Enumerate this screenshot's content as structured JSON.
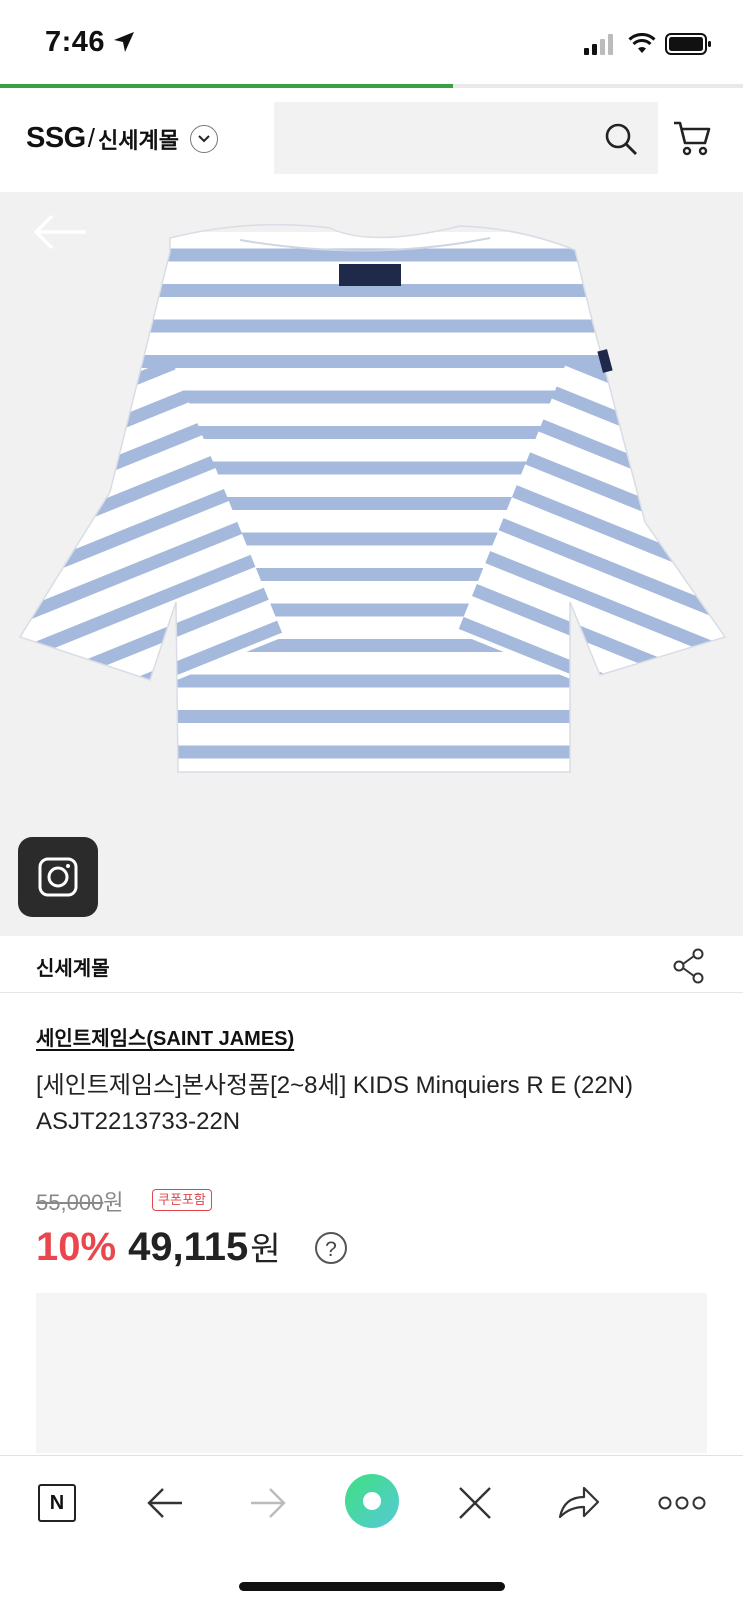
{
  "status_bar": {
    "time": "7:46"
  },
  "page_load_progress": 0.61,
  "header": {
    "logo_brand": "SSG",
    "logo_separator": "/",
    "logo_mall": "신세계몰",
    "search_placeholder": ""
  },
  "store": {
    "name": "신세계몰"
  },
  "product": {
    "brand": "세인트제임스(SAINT JAMES)",
    "title": "[세인트제임스]본사정품[2~8세] KIDS Minquiers R E (22N) ASJT2213733-22N",
    "original_price": "55,000",
    "original_price_unit": "원",
    "coupon_badge": "쿠폰포함",
    "discount": "10%",
    "sale_price": "49,115",
    "sale_price_unit": "원",
    "help_symbol": "?"
  },
  "bottom_nav": {
    "naver_label": "N",
    "items": [
      "naver-home",
      "back",
      "forward",
      "green-dot",
      "close",
      "share",
      "more"
    ]
  },
  "colors": {
    "accent_red": "#e9464e",
    "progress_green": "#3aa043",
    "stripe_blue": "#9fb7dc",
    "dot_green": "#4fd59f"
  }
}
